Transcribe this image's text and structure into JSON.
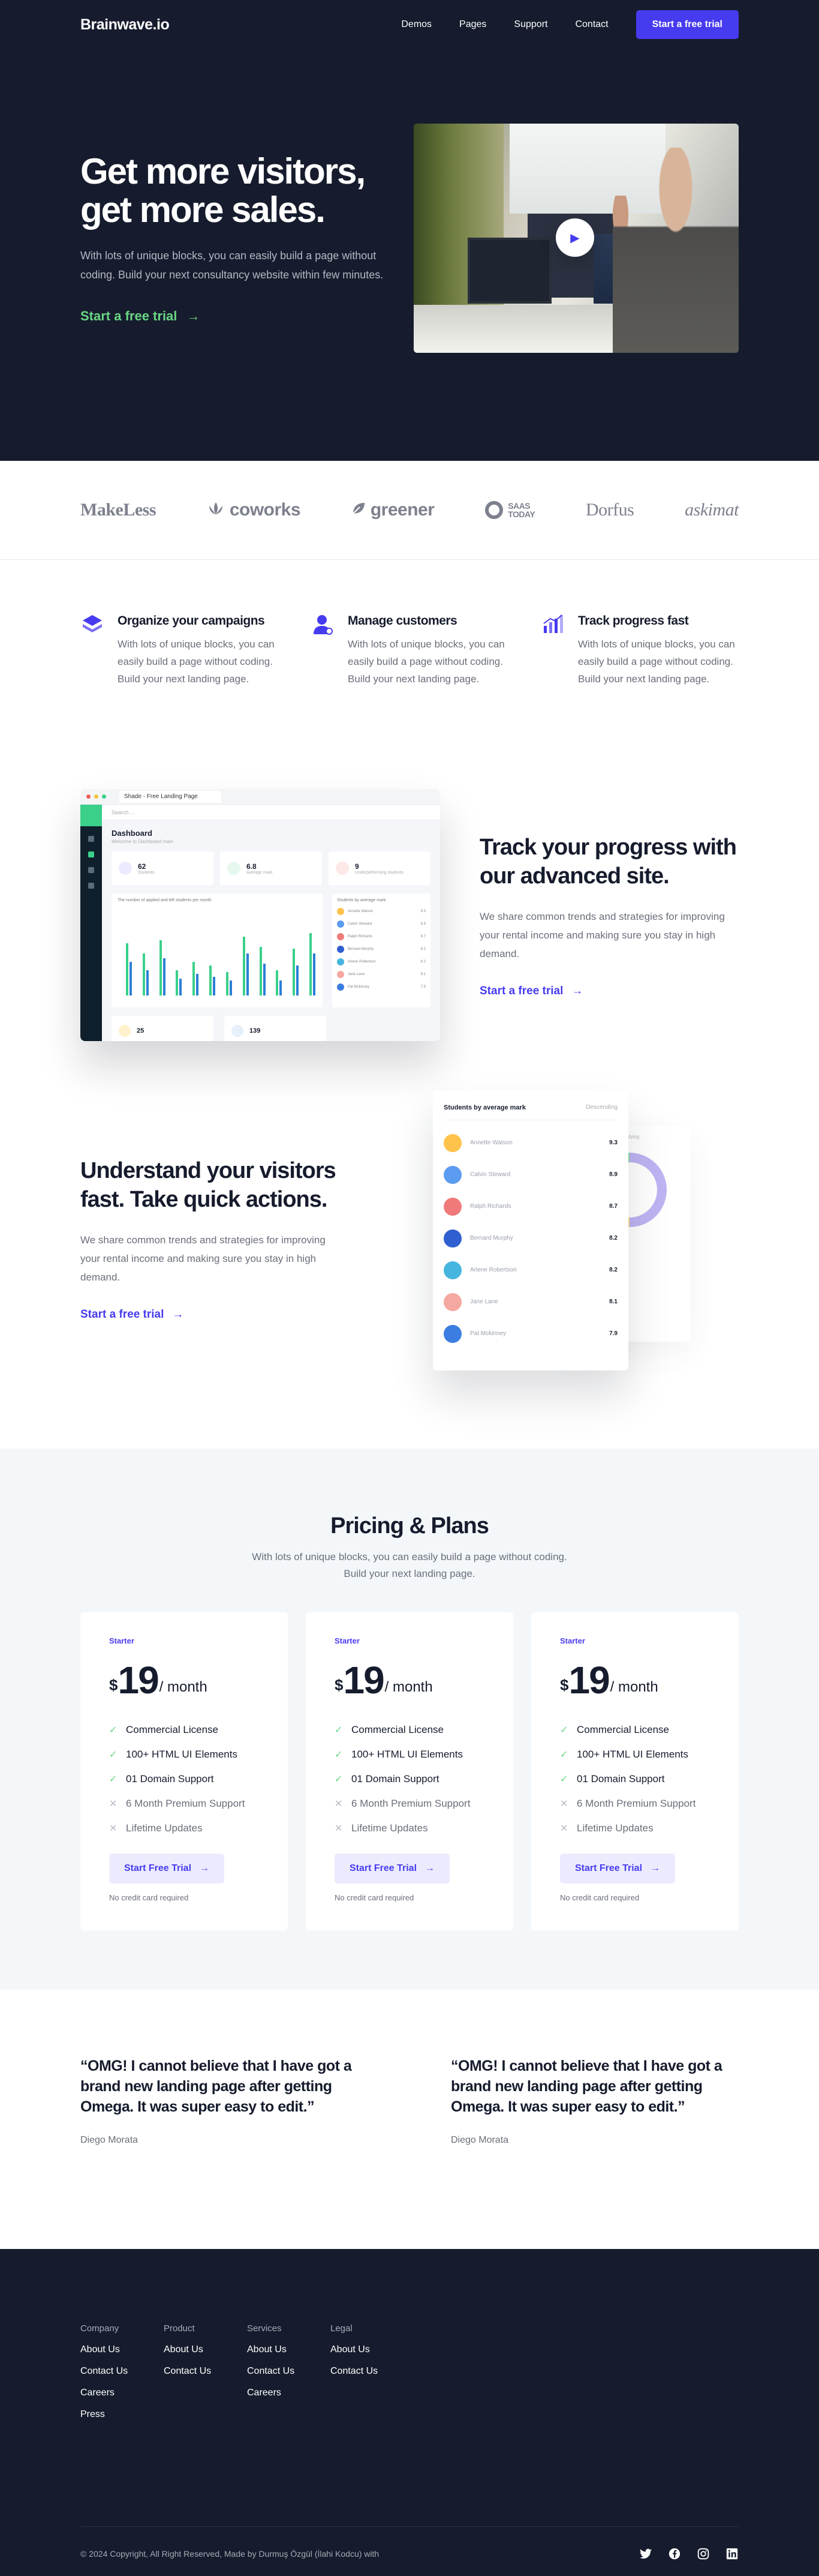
{
  "nav": {
    "logo": "Brainwave.io",
    "links": [
      "Demos",
      "Pages",
      "Support",
      "Contact"
    ],
    "cta": "Start a free trial"
  },
  "hero": {
    "title_line1": "Get more visitors,",
    "title_line2": "get more sales.",
    "subtitle": "With lots of unique blocks, you can easily build a page without coding. Build your next consultancy website within few minutes.",
    "cta": "Start a free trial",
    "arrow": "→",
    "play_icon": "▶"
  },
  "brands": {
    "makeless": "MakeLess",
    "coworks": "coworks",
    "greener": "greener",
    "saas_line1": "SAAS",
    "saas_line2": "TODAY",
    "dorfus": "Dorfus",
    "askimat": "askimat"
  },
  "features": [
    {
      "title": "Organize your campaigns",
      "text": "With lots of unique blocks, you can easily build a page without coding. Build your next landing page.",
      "icon": "layers-icon",
      "color": "#473bf0"
    },
    {
      "title": "Manage customers",
      "text": "With lots of unique blocks, you can easily build a page without coding. Build your next landing page.",
      "icon": "user-icon",
      "color": "#473bf0"
    },
    {
      "title": "Track progress fast",
      "text": "With lots of unique blocks, you can easily build a page without coding. Build your next landing page.",
      "icon": "bar-chart-icon",
      "color": "#473bf0"
    }
  ],
  "dashboard": {
    "tab_title": "Shade - Free Landing Page",
    "search": "Search ...",
    "title": "Dashboard",
    "subtitle": "Welcome to Dashboard main",
    "stats": [
      {
        "value": "62",
        "label": "Students",
        "color": "#ecebfe"
      },
      {
        "value": "6.8",
        "label": "Average mark",
        "color": "#e6f8ed"
      },
      {
        "value": "9",
        "label": "Underperforming students",
        "color": "#fde8e8"
      }
    ],
    "chart_title": "The number of applied and left students per month",
    "list_title": "Students by average mark",
    "mini_stats": [
      {
        "value": "25",
        "color": "#fff2cc"
      },
      {
        "value": "139",
        "color": "#e6f0fb"
      }
    ]
  },
  "content1": {
    "title": "Track your progress with our advanced site.",
    "subtitle": "We share common trends and strategies for improving your rental income and making sure you stay in high demand.",
    "cta": "Start a free trial"
  },
  "content2": {
    "title": "Understand your visitors fast. Take quick actions.",
    "subtitle": "We share common trends and strategies for improving your rental income and making sure you stay in high demand.",
    "cta": "Start a free trial",
    "card_title": "Students by average mark",
    "card_sort": "Descending",
    "back_title": "Type of studying",
    "students": [
      {
        "name": "Annette Watson",
        "score": "9.3",
        "color": "#ffc24a"
      },
      {
        "name": "Calvin Steward",
        "score": "8.9",
        "color": "#5b9cf0"
      },
      {
        "name": "Ralph Richards",
        "score": "8.7",
        "color": "#f07a7a"
      },
      {
        "name": "Bernard Murphy",
        "score": "8.2",
        "color": "#2f5fd0"
      },
      {
        "name": "Arlene Robertson",
        "score": "8.2",
        "color": "#46b6e0"
      },
      {
        "name": "Jane Lane",
        "score": "8.1",
        "color": "#f5a8a0"
      },
      {
        "name": "Pat Mckinney",
        "score": "7.9",
        "color": "#3b7de0"
      }
    ]
  },
  "pricing": {
    "title": "Pricing & Plans",
    "subtitle": "With lots of unique blocks, you can easily build a page without coding. Build your next landing page.",
    "plans": [
      {
        "name": "Starter",
        "currency": "$",
        "amount": "19",
        "period": "/ month",
        "button": "Start Free Trial",
        "note": "No credit card required"
      },
      {
        "name": "Starter",
        "currency": "$",
        "amount": "19",
        "period": "/ month",
        "button": "Start Free Trial",
        "note": "No credit card required"
      },
      {
        "name": "Starter",
        "currency": "$",
        "amount": "19",
        "period": "/ month",
        "button": "Start Free Trial",
        "note": "No credit card required"
      }
    ],
    "features": [
      {
        "text": "Commercial License",
        "included": true
      },
      {
        "text": "100+ HTML UI Elements",
        "included": true
      },
      {
        "text": "01 Domain Support",
        "included": true
      },
      {
        "text": "6 Month Premium Support",
        "included": false
      },
      {
        "text": "Lifetime Updates",
        "included": false
      }
    ]
  },
  "testimonials": [
    {
      "quote": "“OMG! I cannot believe that I have got a brand new landing page after getting Omega. It was super easy to edit.”",
      "name": "Diego Morata"
    },
    {
      "quote": "“OMG! I cannot believe that I have got a brand new landing page after getting Omega. It was super easy to edit.”",
      "name": "Diego Morata"
    }
  ],
  "footer": {
    "columns": [
      {
        "heading": "Company",
        "links": [
          "About Us",
          "Contact Us",
          "Careers",
          "Press"
        ]
      },
      {
        "heading": "Product",
        "links": [
          "About Us",
          "Contact Us"
        ]
      },
      {
        "heading": "Services",
        "links": [
          "About Us",
          "Contact Us",
          "Careers"
        ]
      },
      {
        "heading": "Legal",
        "links": [
          "About Us",
          "Contact Us"
        ]
      }
    ],
    "copyright": "© 2024 Copyright, All Right Reserved, Made by Durmuş Özgül (İlahi Kodcu) with",
    "socials": [
      "twitter-icon",
      "facebook-icon",
      "instagram-icon",
      "linkedin-icon"
    ]
  },
  "colors": {
    "primary": "#473bf0",
    "accent_green": "#68d585",
    "dark": "#161c2d"
  }
}
